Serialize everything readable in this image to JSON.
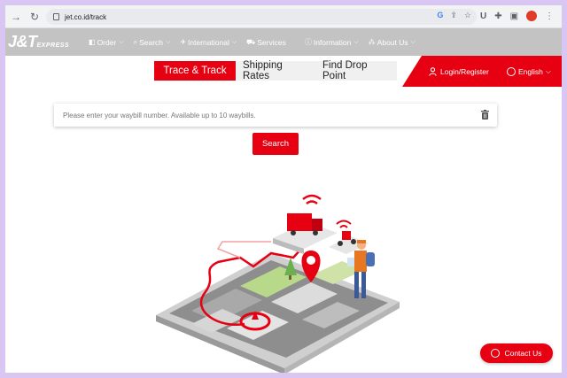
{
  "browser": {
    "url": "jet.co.id/track"
  },
  "site": {
    "logo_main": "J&T",
    "logo_sub": "EXPRESS",
    "menu": [
      {
        "label": "Order"
      },
      {
        "label": "Search"
      },
      {
        "label": "International"
      },
      {
        "label": "Services"
      },
      {
        "label": "Information"
      },
      {
        "label": "About Us"
      }
    ]
  },
  "tabs": [
    {
      "label": "Trace & Track"
    },
    {
      "label": "Shipping Rates"
    },
    {
      "label": "Find Drop Point"
    }
  ],
  "header_right": {
    "login": "Login/Register",
    "language": "English"
  },
  "waybill": {
    "placeholder": "Please enter your waybill number. Available up to 10 waybills.",
    "value": ""
  },
  "search_button": "Search",
  "contact_button": "Contact Us",
  "colors": {
    "brand_red": "#e60012",
    "nav_gray": "#c3c3c3"
  }
}
